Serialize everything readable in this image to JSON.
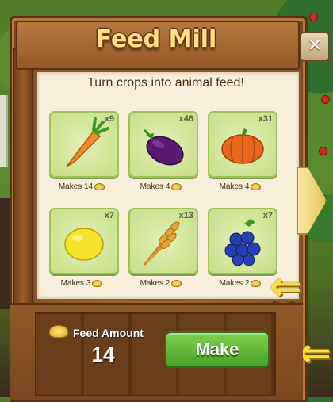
{
  "window": {
    "title": "Feed Mill",
    "close_label": "✕"
  },
  "panel": {
    "subtitle": "Turn crops into animal feed!",
    "crops": [
      {
        "name": "carrot",
        "count": "x9",
        "makes": "Makes 14"
      },
      {
        "name": "eggplant",
        "count": "x46",
        "makes": "Makes 4"
      },
      {
        "name": "pumpkin",
        "count": "x31",
        "makes": "Makes 4"
      },
      {
        "name": "lemon",
        "count": "x7",
        "makes": "Makes 3"
      },
      {
        "name": "wheat",
        "count": "x13",
        "makes": "Makes 2"
      },
      {
        "name": "blueberries",
        "count": "x7",
        "makes": "Makes 2"
      }
    ]
  },
  "footer": {
    "feed_label": "Feed Amount",
    "feed_value": "14",
    "make_label": "Make"
  },
  "icons": {
    "close": "close-icon",
    "next": "arrow-right-icon",
    "pointer": "arrow-left-icon",
    "feed": "feed-pile-icon"
  }
}
